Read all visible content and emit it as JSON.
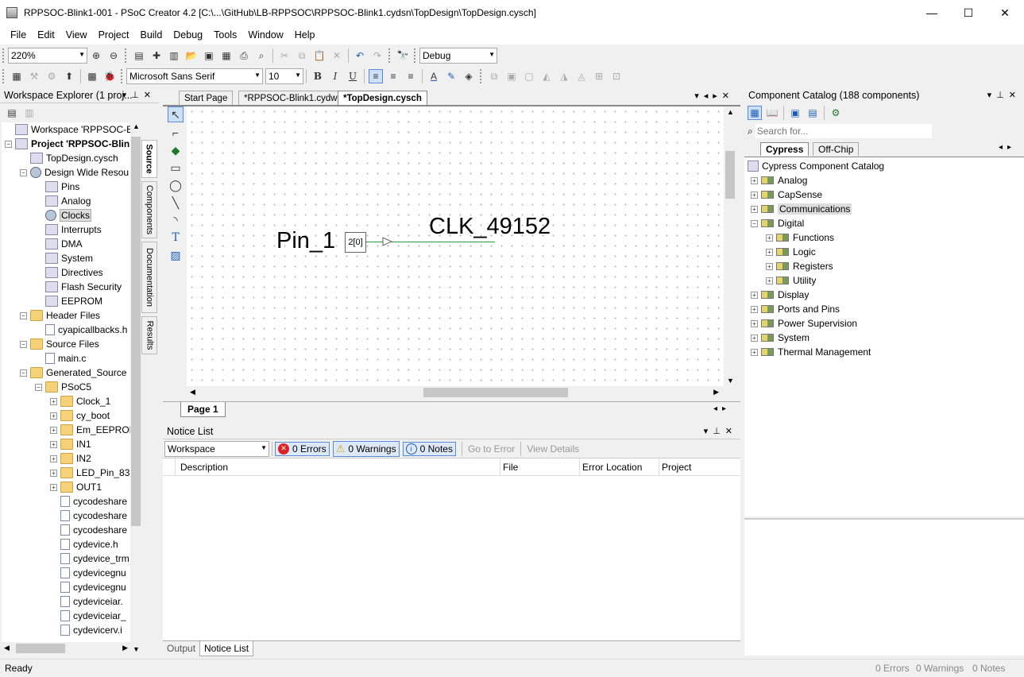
{
  "window": {
    "title": "RPPSOC-Blink1-001 - PSoC Creator 4.2  [C:\\...\\GitHub\\LB-RPPSOC\\RPPSOC-Blink1.cydsn\\TopDesign\\TopDesign.cysch]",
    "minimize": "—",
    "maximize": "☐",
    "close": "✕"
  },
  "menu": [
    "File",
    "Edit",
    "View",
    "Project",
    "Build",
    "Debug",
    "Tools",
    "Window",
    "Help"
  ],
  "toolbar": {
    "zoom": "220%",
    "config": "Debug",
    "font_family": "Microsoft Sans Serif",
    "font_size": "10",
    "bold": "B",
    "italic": "I",
    "underline": "U"
  },
  "workspace_explorer": {
    "title": "Workspace Explorer (1 proj...",
    "side_tabs": [
      "Source",
      "Components",
      "Documentation",
      "Results"
    ],
    "tree": [
      {
        "label": "Workspace 'RPPSOC-Blink",
        "level": 0,
        "icon": "workspace",
        "exp": ""
      },
      {
        "label": "Project  'RPPSOC-Blin",
        "level": 0,
        "icon": "project",
        "exp": "-",
        "bold": true
      },
      {
        "label": "TopDesign.cysch",
        "level": 1,
        "icon": "schematic",
        "exp": ""
      },
      {
        "label": "Design Wide Resou",
        "level": 1,
        "icon": "gear",
        "exp": "-"
      },
      {
        "label": "Pins",
        "level": 2,
        "icon": "pins",
        "exp": ""
      },
      {
        "label": "Analog",
        "level": 2,
        "icon": "analog",
        "exp": ""
      },
      {
        "label": "Clocks",
        "level": 2,
        "icon": "clock",
        "exp": "",
        "selected": true
      },
      {
        "label": "Interrupts",
        "level": 2,
        "icon": "interrupt",
        "exp": ""
      },
      {
        "label": "DMA",
        "level": 2,
        "icon": "dma",
        "exp": ""
      },
      {
        "label": "System",
        "level": 2,
        "icon": "system",
        "exp": ""
      },
      {
        "label": "Directives",
        "level": 2,
        "icon": "directives",
        "exp": ""
      },
      {
        "label": "Flash Security",
        "level": 2,
        "icon": "lock",
        "exp": ""
      },
      {
        "label": "EEPROM",
        "level": 2,
        "icon": "eeprom",
        "exp": ""
      },
      {
        "label": "Header Files",
        "level": 1,
        "icon": "folder",
        "exp": "-"
      },
      {
        "label": "cyapicallbacks.h",
        "level": 2,
        "icon": "hfile",
        "exp": ""
      },
      {
        "label": "Source Files",
        "level": 1,
        "icon": "folder",
        "exp": "-"
      },
      {
        "label": "main.c",
        "level": 2,
        "icon": "cfile",
        "exp": ""
      },
      {
        "label": "Generated_Source",
        "level": 1,
        "icon": "folder",
        "exp": "-"
      },
      {
        "label": "PSoC5",
        "level": 2,
        "icon": "folder",
        "exp": "-"
      },
      {
        "label": "Clock_1",
        "level": 3,
        "icon": "folder",
        "exp": "+"
      },
      {
        "label": "cy_boot",
        "level": 3,
        "icon": "folder",
        "exp": "+"
      },
      {
        "label": "Em_EEPROM",
        "level": 3,
        "icon": "folder",
        "exp": "+"
      },
      {
        "label": "IN1",
        "level": 3,
        "icon": "folder",
        "exp": "+"
      },
      {
        "label": "IN2",
        "level": 3,
        "icon": "folder",
        "exp": "+"
      },
      {
        "label": "LED_Pin_83",
        "level": 3,
        "icon": "folder",
        "exp": "+"
      },
      {
        "label": "OUT1",
        "level": 3,
        "icon": "folder",
        "exp": "+"
      },
      {
        "label": "cycodeshare",
        "level": 3,
        "icon": "file",
        "exp": ""
      },
      {
        "label": "cycodeshare",
        "level": 3,
        "icon": "file",
        "exp": ""
      },
      {
        "label": "cycodeshare",
        "level": 3,
        "icon": "file",
        "exp": ""
      },
      {
        "label": "cydevice.h",
        "level": 3,
        "icon": "hfile",
        "exp": ""
      },
      {
        "label": "cydevice_trm",
        "level": 3,
        "icon": "hfile",
        "exp": ""
      },
      {
        "label": "cydevicegnu",
        "level": 3,
        "icon": "file",
        "exp": ""
      },
      {
        "label": "cydevicegnu",
        "level": 3,
        "icon": "file",
        "exp": ""
      },
      {
        "label": "cydeviceiar.",
        "level": 3,
        "icon": "file",
        "exp": ""
      },
      {
        "label": "cydeviceiar_",
        "level": 3,
        "icon": "file",
        "exp": ""
      },
      {
        "label": "cydevicerv.i",
        "level": 3,
        "icon": "file",
        "exp": ""
      }
    ]
  },
  "document_tabs": [
    {
      "label": "Start Page",
      "active": false
    },
    {
      "label": "*RPPSOC-Blink1.cydwr",
      "active": false
    },
    {
      "label": "*TopDesign.cysch",
      "active": true
    }
  ],
  "schematic": {
    "pin_label": "Pin_1",
    "pin_box": "2[0]",
    "clock_label": "CLK_49152",
    "page_tab": "Page 1"
  },
  "notice_list": {
    "title": "Notice List",
    "scope": "Workspace",
    "errors": "0 Errors",
    "warnings": "0 Warnings",
    "notes": "0 Notes",
    "go_to_error": "Go to Error",
    "view_details": "View Details",
    "columns": [
      "Description",
      "File",
      "Error Location",
      "Project"
    ],
    "bottom_tabs": [
      "Output",
      "Notice List"
    ]
  },
  "catalog": {
    "title": "Component Catalog (188 components)",
    "search_placeholder": "Search for...",
    "tabs": [
      "Cypress",
      "Off-Chip"
    ],
    "root": "Cypress Component Catalog",
    "items": [
      {
        "label": "Analog",
        "level": 0,
        "exp": "+"
      },
      {
        "label": "CapSense",
        "level": 0,
        "exp": "+"
      },
      {
        "label": "Communications",
        "level": 0,
        "exp": "+",
        "selected": true
      },
      {
        "label": "Digital",
        "level": 0,
        "exp": "-"
      },
      {
        "label": "Functions",
        "level": 1,
        "exp": "+"
      },
      {
        "label": "Logic",
        "level": 1,
        "exp": "+"
      },
      {
        "label": "Registers",
        "level": 1,
        "exp": "+"
      },
      {
        "label": "Utility",
        "level": 1,
        "exp": "+"
      },
      {
        "label": "Display",
        "level": 0,
        "exp": "+"
      },
      {
        "label": "Ports and Pins",
        "level": 0,
        "exp": "+"
      },
      {
        "label": "Power Supervision",
        "level": 0,
        "exp": "+"
      },
      {
        "label": "System",
        "level": 0,
        "exp": "+"
      },
      {
        "label": "Thermal Management",
        "level": 0,
        "exp": "+"
      }
    ]
  },
  "status": {
    "left": "Ready",
    "errors": "0 Errors",
    "warnings": "0 Warnings",
    "notes": "0 Notes"
  }
}
